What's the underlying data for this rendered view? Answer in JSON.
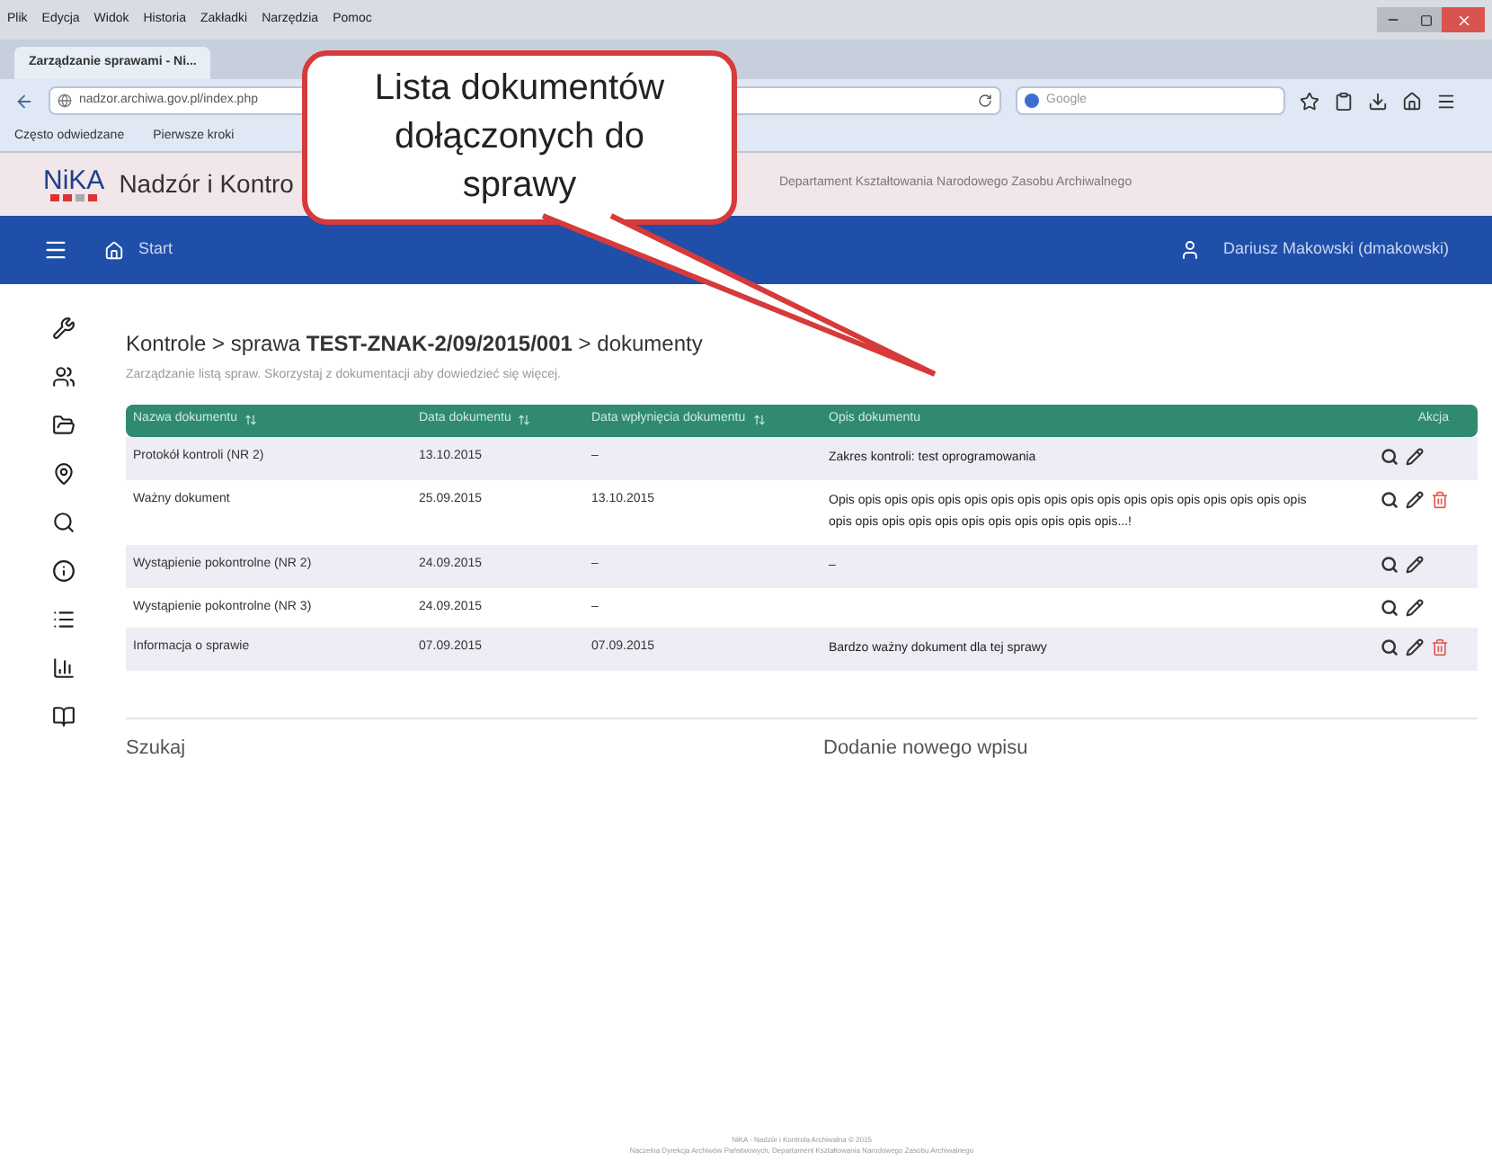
{
  "browser": {
    "menu": [
      "Plik",
      "Edycja",
      "Widok",
      "Historia",
      "Zakładki",
      "Narzędzia",
      "Pomoc"
    ],
    "tabs": [
      {
        "label": "Zarządzanie sprawami - Ni...",
        "selected": true
      }
    ],
    "url": "nadzor.archiwa.gov.pl/index.php",
    "search_placeholder": "Google",
    "bookmarks": [
      "Często odwiedzane",
      "Pierwsze kroki"
    ]
  },
  "app": {
    "logo": "NiKA",
    "title": "Nadzór i Kontro",
    "subtitle": "Departament Kształtowania Narodowego Zasobu Archiwalnego"
  },
  "navbar": {
    "home": "Start",
    "user": "Dariusz Makowski (dmakowski)"
  },
  "sidebar": {
    "items": [
      {
        "kind": "wrench"
      },
      {
        "kind": "users"
      },
      {
        "kind": "folder"
      },
      {
        "kind": "pin"
      },
      {
        "kind": "search"
      },
      {
        "kind": "info"
      },
      {
        "kind": "list"
      },
      {
        "kind": "chart"
      },
      {
        "kind": "book"
      }
    ]
  },
  "breadcrumb": "Kontrole > sprawa **TEST-ZNAK-2/09/2015/001** > dokumenty",
  "description": "Zarządzanie listą spraw. Skorzystaj z dokumentacji aby dowiedzieć się więcej.",
  "table": {
    "columns": [
      {
        "label": "Nazwa dokumentu",
        "sortable": true
      },
      {
        "label": "Data dokumentu",
        "sortable": true
      },
      {
        "label": "Data wpłynięcia dokumentu",
        "sortable": true
      },
      {
        "label": "Opis dokumentu",
        "sortable": false
      },
      {
        "label": "Akcja",
        "sortable": false
      }
    ],
    "rows": [
      {
        "name": "Protokół kontroli (NR 2)",
        "date": "13.10.2015",
        "received": "–",
        "description": "Zakres kontroli: test oprogramowania",
        "deletable": false
      },
      {
        "name": "Ważny dokument",
        "date": "25.09.2015",
        "received": "13.10.2015",
        "description": "Opis opis opis opis opis opis opis opis opis opis opis opis opis opis opis opis opis opis opis opis opis opis opis opis opis opis opis opis opis...!",
        "deletable": true
      },
      {
        "name": "Wystąpienie pokontrolne (NR 2)",
        "date": "24.09.2015",
        "received": "–",
        "description": "–",
        "deletable": false
      },
      {
        "name": "Wystąpienie pokontrolne (NR 3)",
        "date": "24.09.2015",
        "received": "–",
        "deletable": false
      },
      {
        "name": "Informacja o sprawie",
        "date": "07.09.2015",
        "received": "07.09.2015",
        "description": "Bardzo ważny dokument dla tej sprawy",
        "deletable": true
      }
    ]
  },
  "sections": [
    "Szukaj",
    "Dodanie nowego wpisu"
  ],
  "footer": [
    "NiKA - Nadzór i Kontrola Archiwalna © 2015",
    "Naczelna Dyrekcja Archiwów Państwowych, Departament Kształtowania Narodowego Zasobu Archiwalnego"
  ],
  "callout": {
    "text": "Lista dokumentów dołączonych do sprawy"
  }
}
